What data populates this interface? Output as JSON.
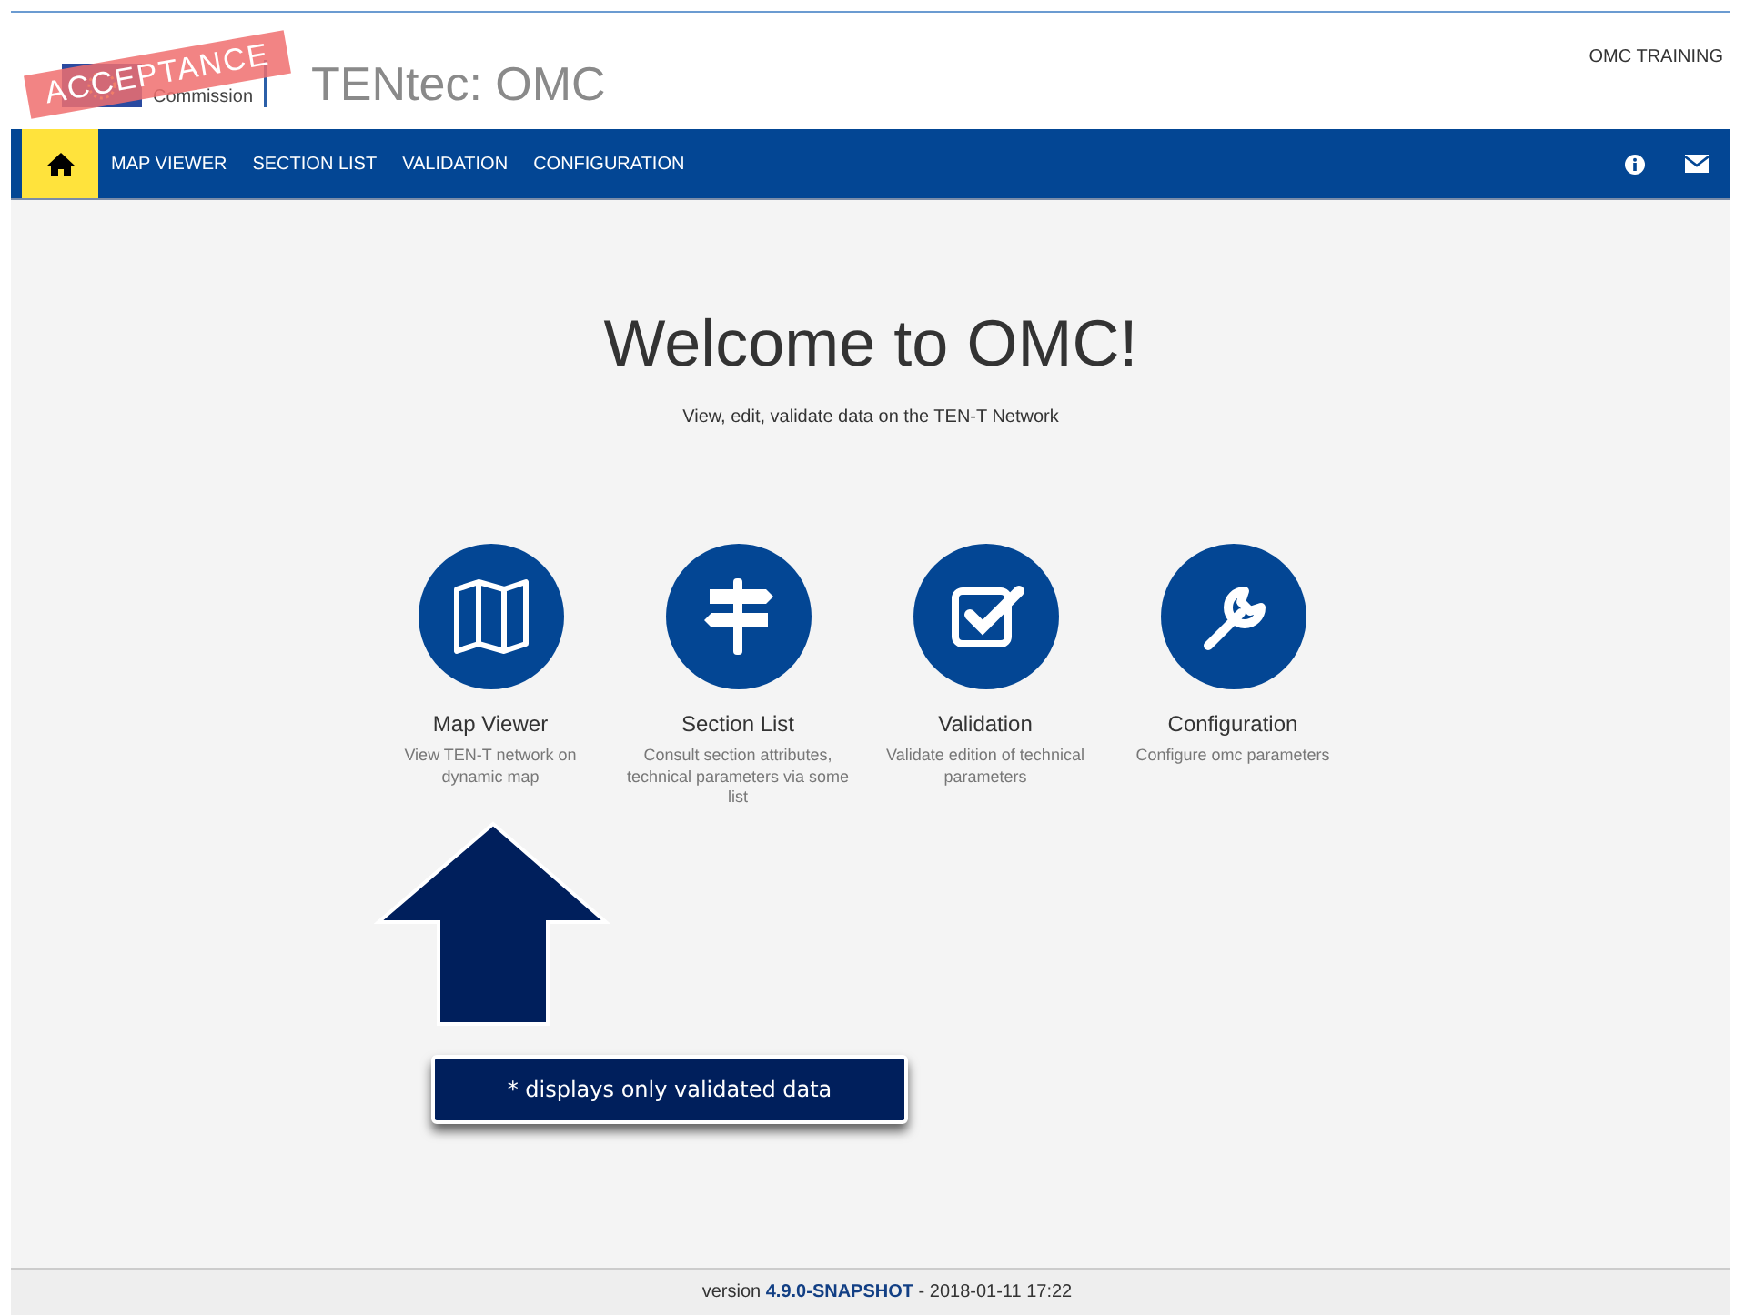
{
  "header": {
    "logo_text": "Commission",
    "environment_badge": "ACCEPTANCE",
    "app_title": "TENtec: OMC",
    "user": "OMC TRAINING"
  },
  "nav": {
    "home_selected": true,
    "items": [
      {
        "label": "MAP VIEWER",
        "selected": false
      },
      {
        "label": "SECTION LIST",
        "selected": false
      },
      {
        "label": "VALIDATION",
        "selected": false
      },
      {
        "label": "CONFIGURATION",
        "selected": false
      }
    ]
  },
  "welcome": {
    "title": "Welcome to OMC!",
    "subtitle": "View, edit, validate data on the TEN-T Network"
  },
  "tiles": [
    {
      "kind": "map",
      "title": "Map Viewer",
      "description": "View TEN-T network on dynamic map"
    },
    {
      "kind": "signpost",
      "title": "Section List",
      "description": "Consult section attributes, technical parameters via some list"
    },
    {
      "kind": "check",
      "title": "Validation",
      "description": "Validate edition of technical parameters"
    },
    {
      "kind": "wrench",
      "title": "Configuration",
      "description": "Configure omc parameters"
    }
  ],
  "callout": "* displays only validated data",
  "footer": "version **4.9.0-SNAPSHOT** - 2018-01-11 17:22"
}
